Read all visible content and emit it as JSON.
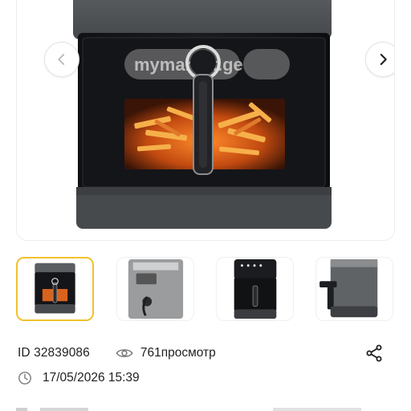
{
  "listing": {
    "watermark": "mymarket.ge",
    "id_text": "ID 32839086",
    "views_text": "761просмотр",
    "date_text": "17/05/2026 15:39"
  },
  "gallery": {
    "thumbnail_count": 4,
    "active_thumbnail": 1,
    "accent_color": "#f2c12e"
  },
  "icons": {
    "prev": "chevron-left-icon",
    "next": "chevron-right-icon",
    "views": "eye-icon",
    "date": "clock-icon",
    "share": "share-icon"
  }
}
